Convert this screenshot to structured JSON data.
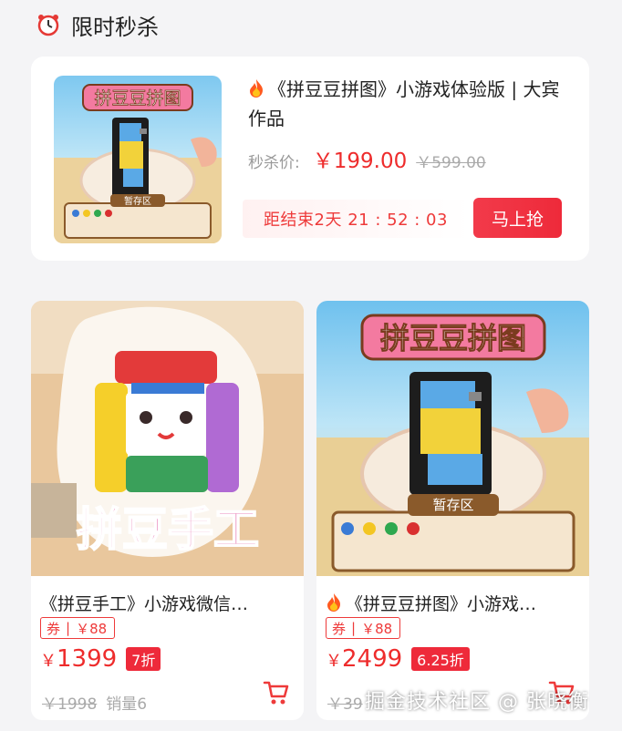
{
  "header": {
    "title": "限时秒杀",
    "icon": "alarm-clock-icon"
  },
  "flash_sale": {
    "title": "《拼豆豆拼图》小游戏体验版 | 大宾作品",
    "price_label": "秒杀价:",
    "price": "￥199.00",
    "original_price": "￥599.00",
    "countdown_text": "距结束2天 21 : 52 : 03",
    "buy_label": "马上抢",
    "image": {
      "banner_text": "拼豆豆拼图",
      "tray_label": "暂存区"
    }
  },
  "products": [
    {
      "title": "《拼豆手工》小游戏微信…",
      "coupon_prefix": "券",
      "coupon_value": "￥88",
      "price_symbol": "￥",
      "price": "1399",
      "discount": "7折",
      "original_price": "￥1998",
      "sales": "销量6",
      "image_text": "拼豆手工"
    },
    {
      "title": "《拼豆豆拼图》小游戏…",
      "coupon_prefix": "券",
      "coupon_value": "￥88",
      "price_symbol": "￥",
      "price": "2499",
      "discount": "6.25折",
      "original_price": "￥39",
      "sales": "",
      "image_text": "拼豆豆拼图",
      "tray_label": "暂存区"
    }
  ],
  "watermark": "掘金技术社区 @ 张晓衡",
  "colors": {
    "accent_red": "#ee2c2c",
    "background": "#f4f4f6"
  }
}
